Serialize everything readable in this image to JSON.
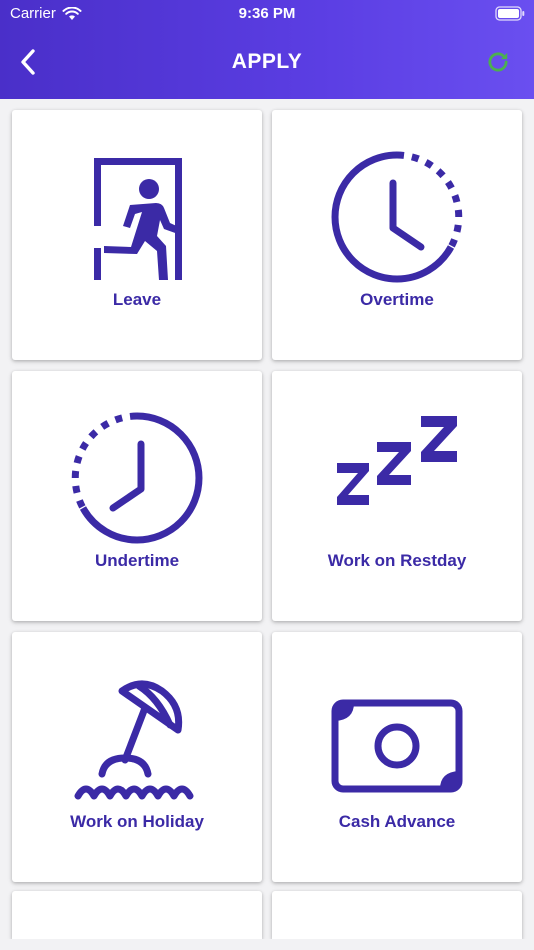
{
  "status_bar": {
    "carrier": "Carrier",
    "time": "9:36 PM"
  },
  "navbar": {
    "title": "APPLY"
  },
  "colors": {
    "header_start": "#4a2fc9",
    "header_end": "#6a4ff0",
    "icon": "#3b2aa6",
    "refresh": "#4caf50",
    "background": "#f2f2f4"
  },
  "items": [
    {
      "label": "Leave",
      "icon": "exit-door-icon"
    },
    {
      "label": "Overtime",
      "icon": "clock-overtime-icon"
    },
    {
      "label": "Undertime",
      "icon": "clock-undertime-icon"
    },
    {
      "label": "Work on Restday",
      "icon": "sleep-zzz-icon"
    },
    {
      "label": "Work on Holiday",
      "icon": "beach-umbrella-icon"
    },
    {
      "label": "Cash Advance",
      "icon": "money-bill-icon"
    }
  ]
}
